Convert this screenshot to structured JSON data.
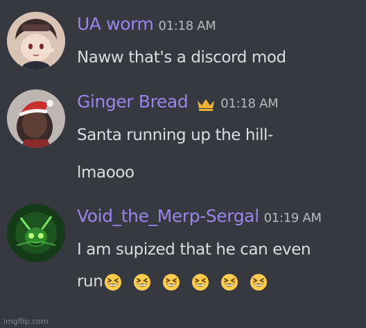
{
  "messages": [
    {
      "username": "UA worm",
      "timestamp": "01:18 AM",
      "avatar": "anime-boy-avatar",
      "lines": [
        "Naww that's a discord mod"
      ]
    },
    {
      "username": "Ginger Bread",
      "timestamp": "01:18 AM",
      "avatar": "santa-hat-avatar",
      "badge": "crown-icon",
      "lines": [
        "Santa running up the hill-",
        "lmaooo"
      ]
    },
    {
      "username": "Void_the_Merp-Sergal",
      "timestamp": "01:19 AM",
      "avatar": "green-creature-avatar",
      "lines": [
        "I am supized that he can even",
        "run"
      ],
      "emoji": "laughing-squint-emoji",
      "emoji_count": 6
    }
  ],
  "watermark": "imgflip.com",
  "colors": {
    "background": "#36393f",
    "username": "#9b84ec",
    "message_text": "#dcddde",
    "timestamp": "#b9bbbe",
    "crown": "#f0b232",
    "emoji_face": "#ffcc4d"
  }
}
